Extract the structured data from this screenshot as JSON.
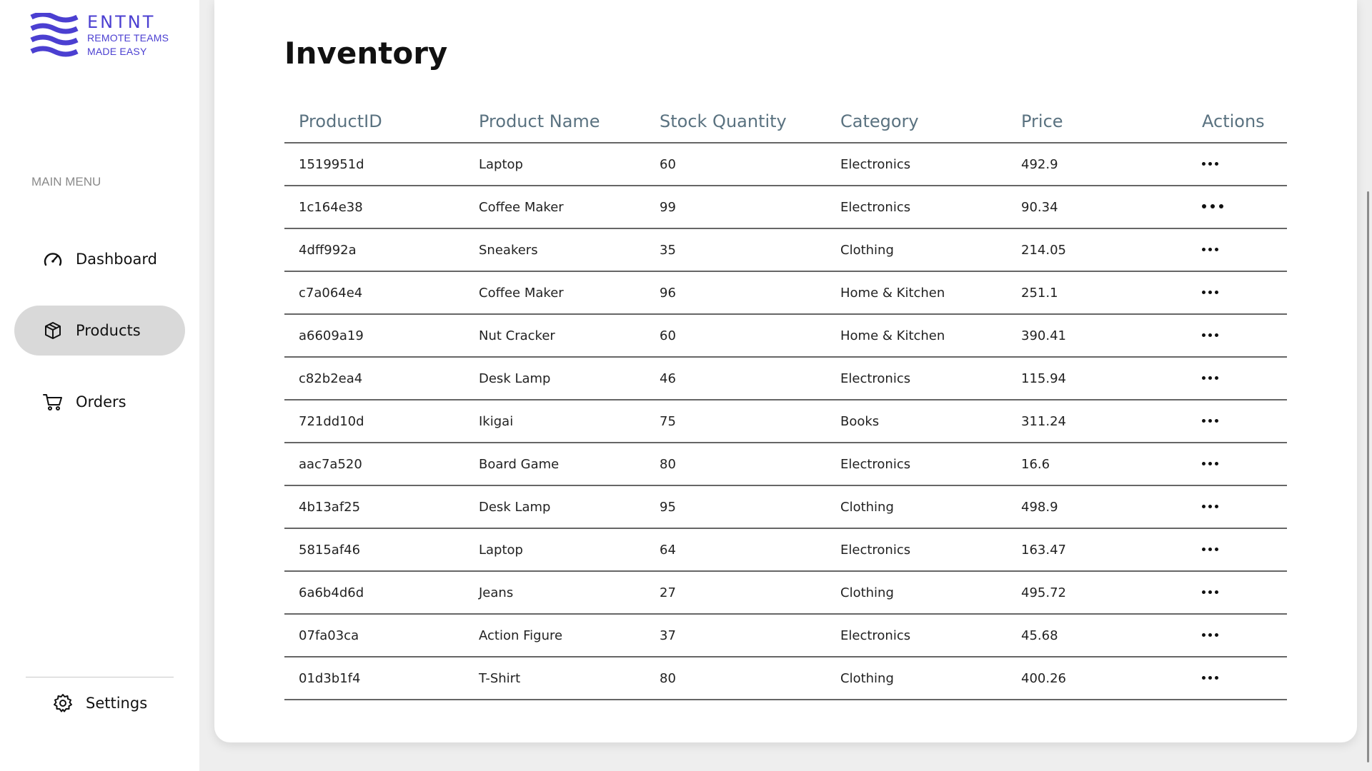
{
  "brand": {
    "name": "ENTNT",
    "tagline_1": "REMOTE TEAMS",
    "tagline_2": "MADE EASY",
    "color": "#4b3fd1"
  },
  "sidebar": {
    "menu_heading": "MAIN MENU",
    "items": [
      {
        "label": "Dashboard",
        "icon": "gauge-icon",
        "active": false
      },
      {
        "label": "Products",
        "icon": "box-icon",
        "active": true
      },
      {
        "label": "Orders",
        "icon": "cart-icon",
        "active": false
      }
    ],
    "settings_label": "Settings"
  },
  "page": {
    "title": "Inventory"
  },
  "table": {
    "headers": [
      "ProductID",
      "Product Name",
      "Stock Quantity",
      "Category",
      "Price",
      "Actions"
    ],
    "rows": [
      {
        "id": "1519951d",
        "name": "Laptop",
        "stock": "60",
        "category": "Electronics",
        "price": "492.9"
      },
      {
        "id": "1c164e38",
        "name": "Coffee Maker",
        "stock": "99",
        "category": "Electronics",
        "price": "90.34"
      },
      {
        "id": "4dff992a",
        "name": "Sneakers",
        "stock": "35",
        "category": "Clothing",
        "price": "214.05"
      },
      {
        "id": "c7a064e4",
        "name": "Coffee Maker",
        "stock": "96",
        "category": "Home & Kitchen",
        "price": "251.1"
      },
      {
        "id": "a6609a19",
        "name": "Nut Cracker",
        "stock": "60",
        "category": "Home & Kitchen",
        "price": "390.41"
      },
      {
        "id": "c82b2ea4",
        "name": "Desk Lamp",
        "stock": "46",
        "category": "Electronics",
        "price": "115.94"
      },
      {
        "id": "721dd10d",
        "name": "Ikigai",
        "stock": "75",
        "category": "Books",
        "price": "311.24"
      },
      {
        "id": "aac7a520",
        "name": "Board Game",
        "stock": "80",
        "category": "Electronics",
        "price": "16.6"
      },
      {
        "id": "4b13af25",
        "name": "Desk Lamp",
        "stock": "95",
        "category": "Clothing",
        "price": "498.9"
      },
      {
        "id": "5815af46",
        "name": "Laptop",
        "stock": "64",
        "category": "Electronics",
        "price": "163.47"
      },
      {
        "id": "6a6b4d6d",
        "name": "Jeans",
        "stock": "27",
        "category": "Clothing",
        "price": "495.72"
      },
      {
        "id": "07fa03ca",
        "name": "Action Figure",
        "stock": "37",
        "category": "Electronics",
        "price": "45.68"
      },
      {
        "id": "01d3b1f4",
        "name": "T-Shirt",
        "stock": "80",
        "category": "Clothing",
        "price": "400.26"
      }
    ]
  }
}
